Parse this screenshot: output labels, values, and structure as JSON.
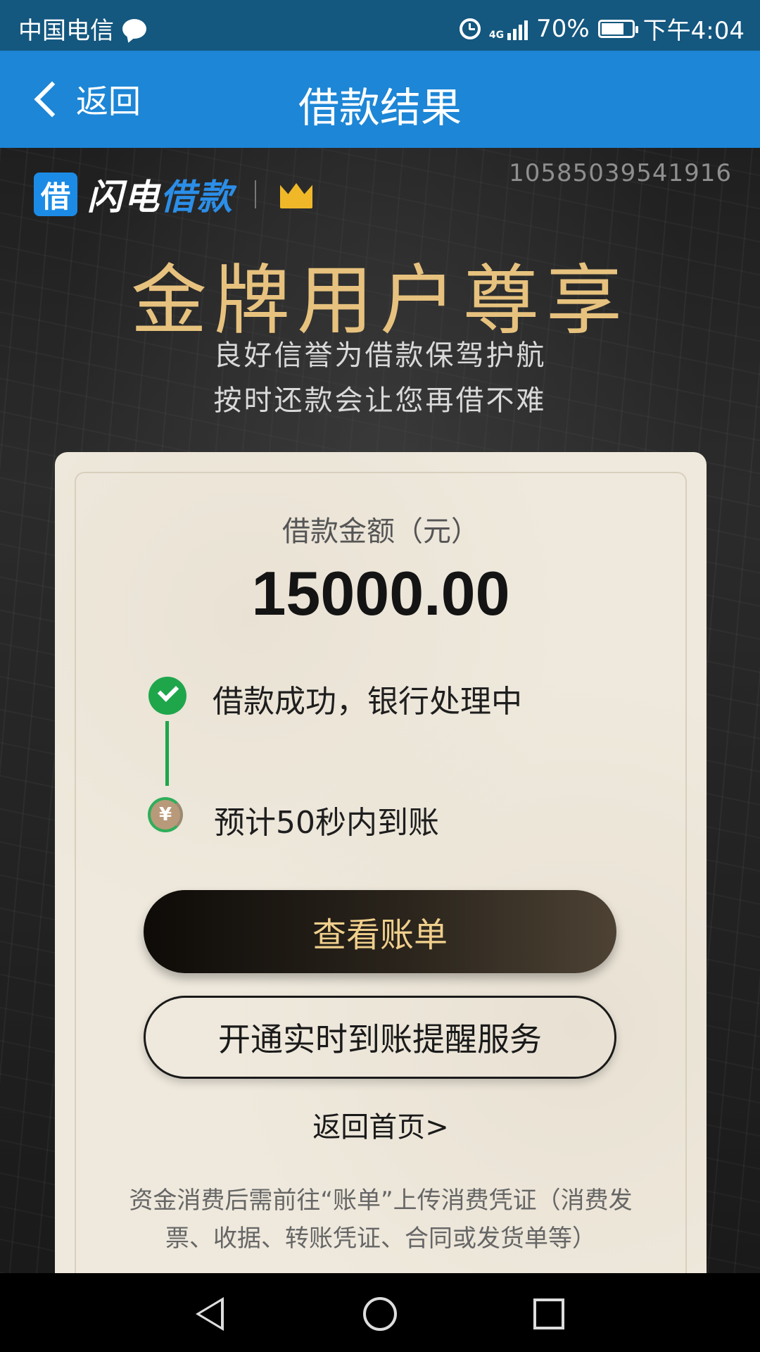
{
  "status_bar": {
    "carrier": "中国电信",
    "battery": "70%",
    "time": "下午4:04",
    "network": "4G"
  },
  "nav": {
    "back_label": "返回",
    "title": "借款结果"
  },
  "hero": {
    "logo_badge": "借",
    "logo_text_a": "闪电",
    "logo_text_b": "借款",
    "order_number": "10585039541916",
    "title": "金牌用户尊享",
    "subtitle_line1": "良好信誉为借款保驾护航",
    "subtitle_line2": "按时还款会让您再借不难"
  },
  "card": {
    "amount_label": "借款金额（元）",
    "amount_value": "15000.00",
    "steps": [
      {
        "text": "借款成功，银行处理中",
        "icon": "check-icon"
      },
      {
        "text": "预计50秒内到账",
        "icon": "coin-icon",
        "coin_symbol": "¥"
      }
    ],
    "primary_button": "查看账单",
    "secondary_button": "开通实时到账提醒服务",
    "home_link": "返回首页>",
    "footnote": "资金消费后需前往“账单”上传消费凭证（消费发票、收据、转账凭证、合同或发货单等）"
  },
  "colors": {
    "status_bar": "#14577f",
    "nav_bar": "#1d86d6",
    "gold": "#e7c27e",
    "success_green": "#1fa64b"
  }
}
